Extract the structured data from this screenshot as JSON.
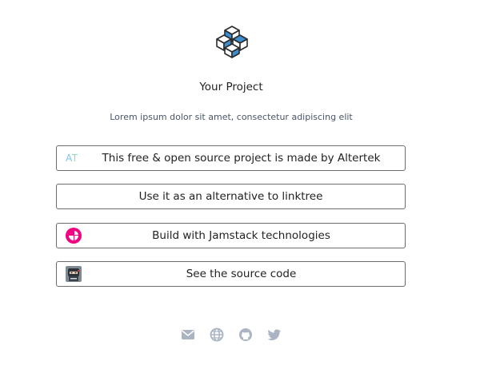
{
  "profile": {
    "title": "Your Project",
    "subtitle": "Lorem ipsum dolor sit amet, consectetur adipiscing elit",
    "logo_icon": "isometric-cubes-logo"
  },
  "links": [
    {
      "label": "This free & open source project is made by Altertek",
      "icon": "altertek-logo",
      "icon_text": "AT"
    },
    {
      "label": "Use it as an alternative to linktree",
      "icon": ""
    },
    {
      "label": "Build with Jamstack technologies",
      "icon": "jamstack-logo"
    },
    {
      "label": "See the source code",
      "icon": "ninja-avatar"
    }
  ],
  "socials": [
    {
      "icon": "mail-icon"
    },
    {
      "icon": "globe-icon"
    },
    {
      "icon": "github-icon"
    },
    {
      "icon": "twitter-icon"
    }
  ],
  "colors": {
    "cube_blue": "#3b8fd1",
    "social_gray": "#aab4c3",
    "jamstack_pink": "#f0047f",
    "border": "#6b6b6b"
  }
}
